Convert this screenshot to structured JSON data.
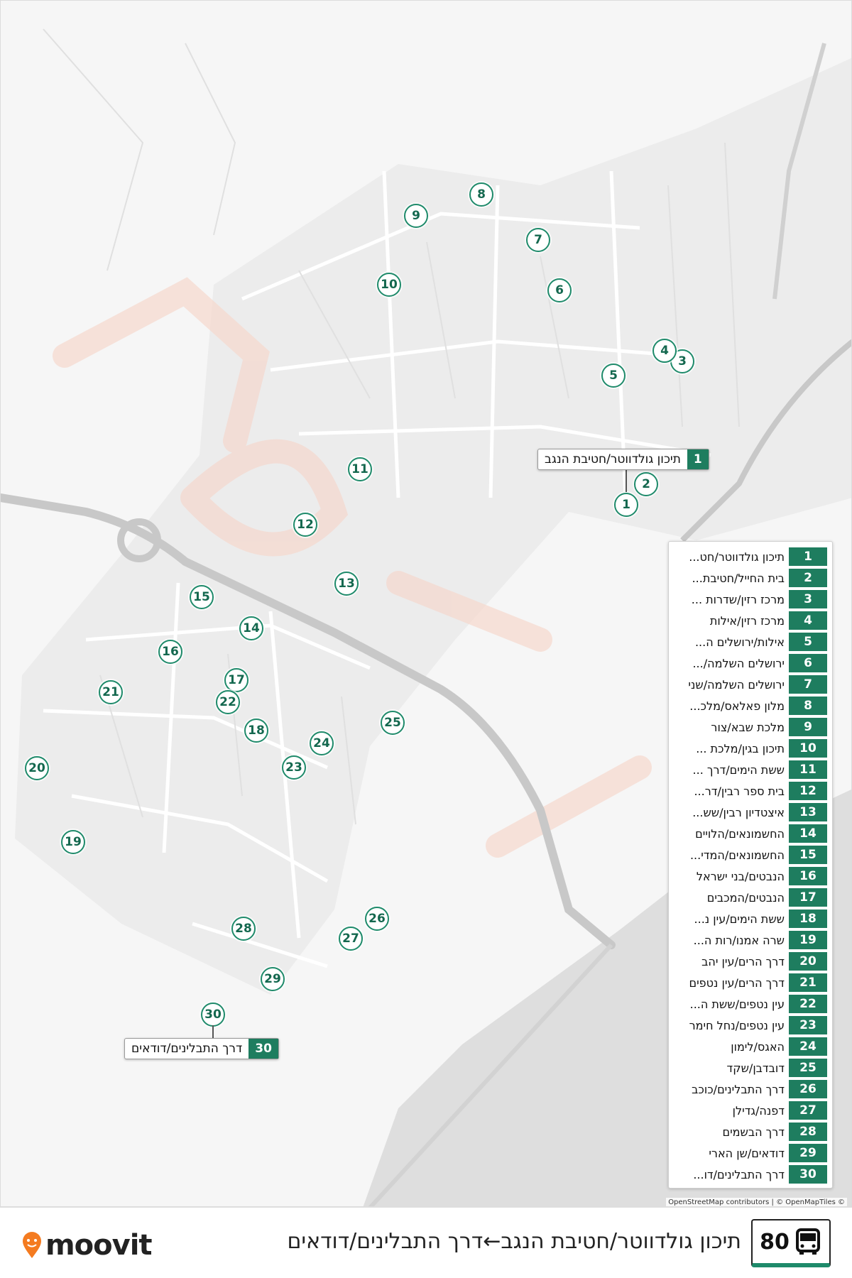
{
  "route": {
    "number": "80",
    "title": "תיכון גולדווטר/חטיבת הנגב←דרך התבלינים/דודאים"
  },
  "brand": {
    "name": "moovit"
  },
  "attribution": "OpenStreetMap contributors | © OpenMapTiles ©",
  "callouts": {
    "first": {
      "number": "1",
      "name": "תיכון גולדווטר/חטיבת הנגב"
    },
    "last": {
      "number": "30",
      "name": "דרך התבלינים/דודאים"
    }
  },
  "stops": [
    {
      "number": "1",
      "name": "תיכון גולדווטר/חט..."
    },
    {
      "number": "2",
      "name": "בית החייל/חטיבת..."
    },
    {
      "number": "3",
      "name": "מרכז רזין/שדרות ..."
    },
    {
      "number": "4",
      "name": "מרכז רזין/אילות"
    },
    {
      "number": "5",
      "name": "אילות/ירושלים ה..."
    },
    {
      "number": "6",
      "name": "ירושלים השלמה/..."
    },
    {
      "number": "7",
      "name": "ירושלים השלמה/שני"
    },
    {
      "number": "8",
      "name": "מלון פאלאס/מלכ..."
    },
    {
      "number": "9",
      "name": "מלכת שבא/צור"
    },
    {
      "number": "10",
      "name": "תיכון בגין/מלכת ..."
    },
    {
      "number": "11",
      "name": "ששת הימים/דרך ..."
    },
    {
      "number": "12",
      "name": "בית ספר רבין/דר..."
    },
    {
      "number": "13",
      "name": "איצטדיון רבין/שש..."
    },
    {
      "number": "14",
      "name": "החשמונאים/הלויים"
    },
    {
      "number": "15",
      "name": "החשמונאים/המדי..."
    },
    {
      "number": "16",
      "name": "הנבטים/בני ישראל"
    },
    {
      "number": "17",
      "name": "הנבטים/המכבים"
    },
    {
      "number": "18",
      "name": "ששת הימים/עין נ..."
    },
    {
      "number": "19",
      "name": "שרה אמנו/רות ה..."
    },
    {
      "number": "20",
      "name": "דרך הרים/עין יהב"
    },
    {
      "number": "21",
      "name": "דרך הרים/עין נטפים"
    },
    {
      "number": "22",
      "name": "עין נטפים/ששת ה..."
    },
    {
      "number": "23",
      "name": "עין נטפים/נחל חימר"
    },
    {
      "number": "24",
      "name": "האגס/לימון"
    },
    {
      "number": "25",
      "name": "דובדבן/שקד"
    },
    {
      "number": "26",
      "name": "דרך התבלינים/כוכב"
    },
    {
      "number": "27",
      "name": "דפנה/גדילן"
    },
    {
      "number": "28",
      "name": "דרך הבשמים"
    },
    {
      "number": "29",
      "name": "דודאים/שן הארי"
    },
    {
      "number": "30",
      "name": "דרך התבלינים/דו..."
    }
  ],
  "colors": {
    "accent": "#1e7d5f",
    "marker_border": "#1e8a6a",
    "road": "#cfcfcf",
    "sea": "#dcdcdc",
    "route_watermark": "#f6d8cf"
  },
  "icons": {
    "brand": "moovit-pin-icon",
    "route": "bus-icon"
  }
}
